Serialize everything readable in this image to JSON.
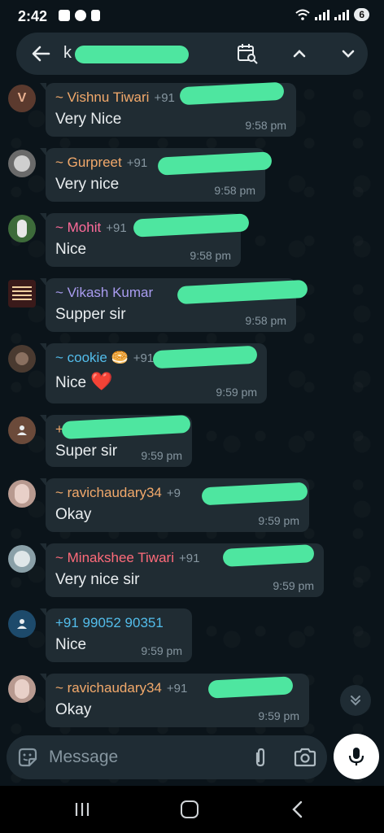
{
  "status_bar": {
    "time": "2:42",
    "battery": "6"
  },
  "search": {
    "query": "k",
    "icons": [
      "back-arrow-icon",
      "calendar-search-icon",
      "chevron-up-icon",
      "chevron-down-icon"
    ]
  },
  "messages": [
    {
      "sender": "~ Vishnu Tiwari",
      "phone": "+91",
      "sender_color": "#f2a96b",
      "text": "Very Nice",
      "time": "9:58 pm",
      "avatar_letter": "V",
      "avatar_bg": "#5b3a2e"
    },
    {
      "sender": "~ Gurpreet",
      "phone": "+91",
      "sender_color": "#f2a96b",
      "text": "Very nice",
      "time": "9:58 pm",
      "avatar_letter": "",
      "avatar_bg": "#6a6a6a"
    },
    {
      "sender": "~ Mohit",
      "phone": "+91",
      "sender_color": "#ff6b9a",
      "text": "Nice",
      "time": "9:58 pm",
      "avatar_letter": "",
      "avatar_bg": "#3d6b3a"
    },
    {
      "sender": "~ Vikash Kumar",
      "phone": "",
      "sender_color": "#a99cf0",
      "text": "Supper sir",
      "time": "9:58 pm",
      "avatar_letter": "",
      "avatar_bg": "#3a1a1a"
    },
    {
      "sender": "~ cookie 🥯",
      "phone": "+91",
      "sender_color": "#53bdeb",
      "text": "Nice",
      "time": "9:59 pm",
      "avatar_letter": "",
      "avatar_bg": "#4a3a30",
      "heart": "❤️"
    },
    {
      "sender": "+",
      "phone": "",
      "sender_color": "#f2a96b",
      "text": "Super sir",
      "time": "9:59 pm",
      "avatar_letter": "",
      "avatar_bg": "#6b4a3a"
    },
    {
      "sender": "~ ravichaudary34",
      "phone": "+9",
      "sender_color": "#f2a96b",
      "text": "Okay",
      "time": "9:59 pm",
      "avatar_letter": "",
      "avatar_bg": "#b89a90"
    },
    {
      "sender": "~ Minakshee Tiwari",
      "phone": "+91",
      "sender_color": "#ff6b7a",
      "text": "Very nice sir",
      "time": "9:59 pm",
      "avatar_letter": "",
      "avatar_bg": "#8aa0a8"
    },
    {
      "sender": "+91 99052 90351",
      "phone": "",
      "sender_color": "#53bdeb",
      "text": "Nice",
      "time": "9:59 pm",
      "avatar_letter": "",
      "avatar_bg": "#1d4a6b"
    },
    {
      "sender": "~ ravichaudary34",
      "phone": "+91",
      "sender_color": "#f2a96b",
      "text": "Okay",
      "time": "9:59 pm",
      "avatar_letter": "",
      "avatar_bg": "#b89a90"
    }
  ],
  "composer": {
    "placeholder": "Message",
    "icons": [
      "emoji-sticker-icon",
      "paperclip-icon",
      "camera-icon",
      "microphone-icon"
    ]
  },
  "colors": {
    "background": "#0b141a",
    "bubble": "#202c33",
    "redaction": "#4ee6a0",
    "meta_text": "#8696a0"
  }
}
